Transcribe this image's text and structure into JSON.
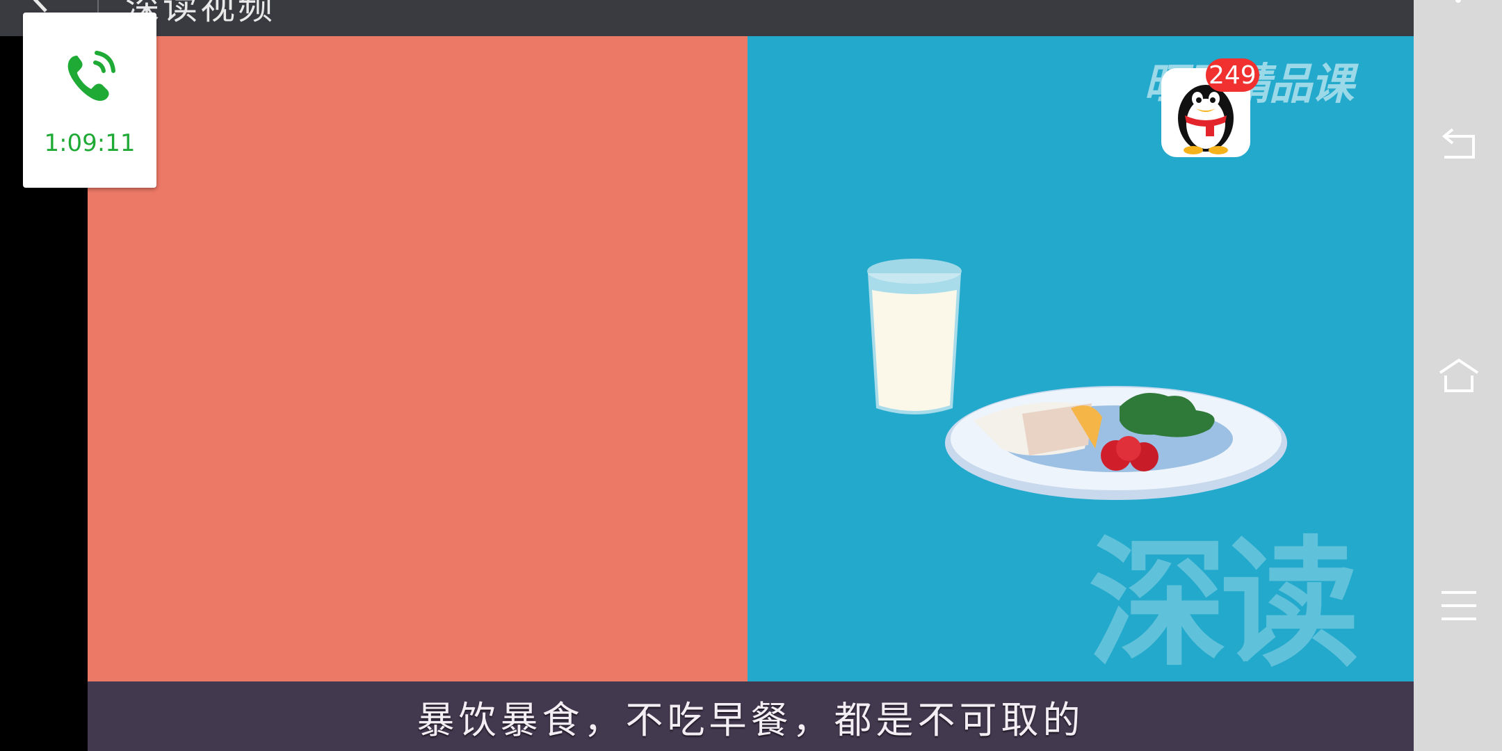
{
  "top_bar": {
    "title": "深读视频",
    "back_icon": "back-arrow-icon"
  },
  "video": {
    "subtitle": "暴饮暴食，不吃早餐，都是不可取的",
    "watermark_top": "旺旺精品课",
    "watermark_bottom": "深读",
    "colors": {
      "left_panel": "#ec7866",
      "right_panel": "#23a9cc",
      "subtitle_band": "#43394f"
    }
  },
  "call_widget": {
    "icon": "phone-icon",
    "timer": "1:09:11",
    "accent": "#1faa36"
  },
  "qq_widget": {
    "icon": "qq-penguin-icon",
    "badge_count": "249",
    "badge_color": "#f0312f"
  },
  "nav_bar": {
    "back_icon": "back-icon",
    "home_icon": "home-icon",
    "menu_icon": "menu-icon"
  }
}
